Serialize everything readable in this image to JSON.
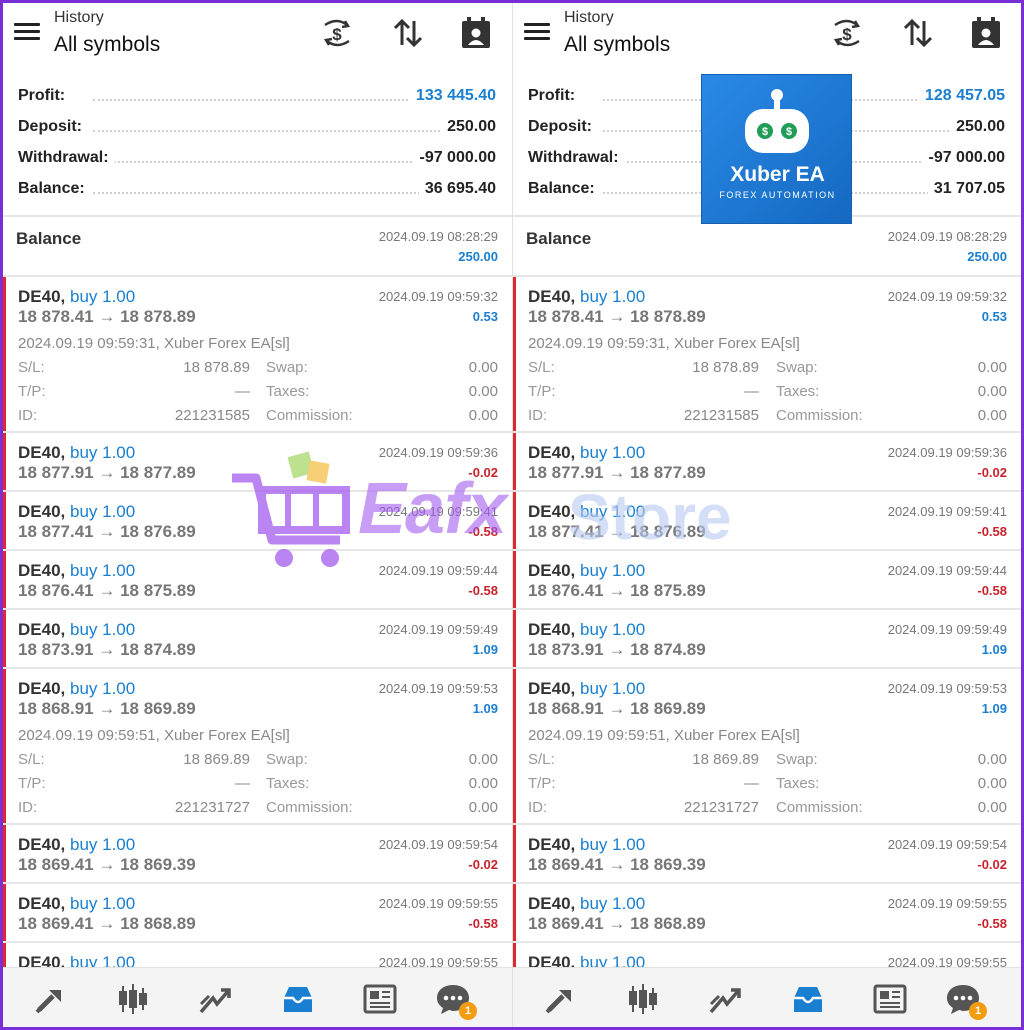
{
  "header": {
    "title": "History",
    "subtitle": "All symbols",
    "icons": [
      "currency-exchange-icon",
      "sort-icon",
      "calendar-icon"
    ]
  },
  "panels": [
    {
      "summary": [
        {
          "label": "Profit:",
          "value": "133 445.40",
          "highlight": true
        },
        {
          "label": "Deposit:",
          "value": "250.00"
        },
        {
          "label": "Withdrawal:",
          "value": "-97 000.00"
        },
        {
          "label": "Balance:",
          "value": "36 695.40"
        }
      ]
    },
    {
      "summary": [
        {
          "label": "Profit:",
          "value": "128 457.05",
          "highlight": true
        },
        {
          "label": "Deposit:",
          "value": "250.00"
        },
        {
          "label": "Withdrawal:",
          "value": "-97 000.00"
        },
        {
          "label": "Balance:",
          "value": "31 707.05"
        }
      ]
    }
  ],
  "balance_entry": {
    "title": "Balance",
    "time": "2024.09.19 08:28:29",
    "amount": "250.00"
  },
  "deal_symbol": "DE40,",
  "deal_type": "buy 1.00",
  "detail_labels": {
    "sl": "S/L:",
    "tp": "T/P:",
    "id": "ID:",
    "swap": "Swap:",
    "taxes": "Taxes:",
    "commission": "Commission:"
  },
  "deals": [
    {
      "prices": "18 878.41 → 18 878.89",
      "time": "2024.09.19 09:59:32",
      "profit": "0.53",
      "positive": true,
      "expanded": true,
      "comment": "2024.09.19 09:59:31, Xuber Forex EA[sl]",
      "sl": "18 878.89",
      "tp": "—",
      "id": "221231585",
      "swap": "0.00",
      "taxes": "0.00",
      "commission": "0.00"
    },
    {
      "prices": "18 877.91 → 18 877.89",
      "time": "2024.09.19 09:59:36",
      "profit": "-0.02",
      "positive": false
    },
    {
      "prices": "18 877.41 → 18 876.89",
      "time": "2024.09.19 09:59:41",
      "profit": "-0.58",
      "positive": false
    },
    {
      "prices": "18 876.41 → 18 875.89",
      "time": "2024.09.19 09:59:44",
      "profit": "-0.58",
      "positive": false
    },
    {
      "prices": "18 873.91 → 18 874.89",
      "time": "2024.09.19 09:59:49",
      "profit": "1.09",
      "positive": true
    },
    {
      "prices": "18 868.91 → 18 869.89",
      "time": "2024.09.19 09:59:53",
      "profit": "1.09",
      "positive": true,
      "expanded": true,
      "comment": "2024.09.19 09:59:51, Xuber Forex EA[sl]",
      "sl": "18 869.89",
      "tp": "—",
      "id": "221231727",
      "swap": "0.00",
      "taxes": "0.00",
      "commission": "0.00"
    },
    {
      "prices": "18 869.41 → 18 869.39",
      "time": "2024.09.19 09:59:54",
      "profit": "-0.02",
      "positive": false
    },
    {
      "prices": "18 869.41 → 18 868.89",
      "time": "2024.09.19 09:59:55",
      "profit": "-0.58",
      "positive": false
    },
    {
      "prices": "",
      "time": "2024.09.19 09:59:55",
      "profit": "",
      "positive": true
    }
  ],
  "bottom_nav": [
    {
      "name": "quotes-icon"
    },
    {
      "name": "chart-icon"
    },
    {
      "name": "trade-icon"
    },
    {
      "name": "history-icon",
      "active": true
    },
    {
      "name": "news-icon"
    },
    {
      "name": "messages-icon",
      "badge": "1"
    }
  ],
  "promo": {
    "name": "Xuber EA",
    "tagline": "FOREX AUTOMATION"
  },
  "watermark": {
    "part1": "Eafx",
    "part2": "Store"
  },
  "colors": {
    "accent": "#1a7fd0",
    "negative": "#c8232c",
    "deal_bar": "#e0262e"
  }
}
